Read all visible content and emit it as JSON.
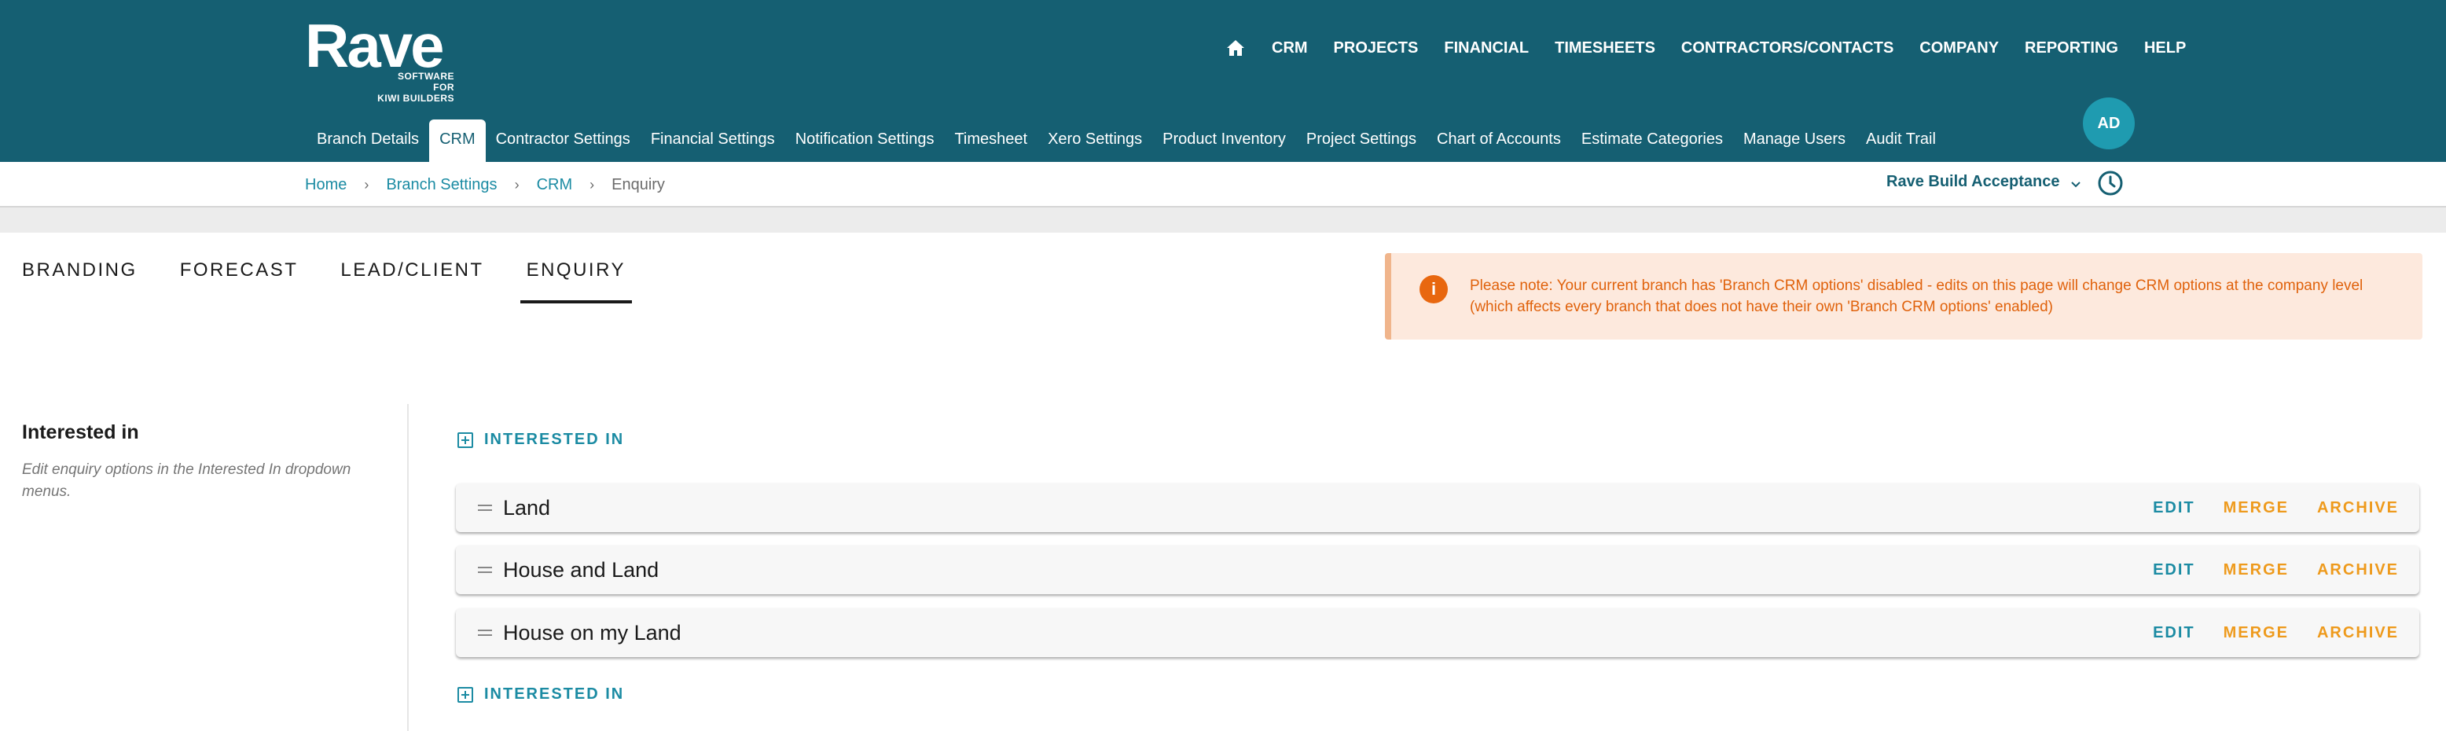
{
  "brand": {
    "name": "Rave",
    "tagline_line1": "SOFTWARE FOR",
    "tagline_line2": "KIWI BUILDERS"
  },
  "top_nav": {
    "home_icon": "home-icon",
    "items": [
      "CRM",
      "PROJECTS",
      "FINANCIAL",
      "TIMESHEETS",
      "CONTRACTORS/CONTACTS",
      "COMPANY",
      "REPORTING",
      "HELP"
    ]
  },
  "user": {
    "initials": "AD"
  },
  "settings_tabs": {
    "items": [
      "Branch Details",
      "CRM",
      "Contractor Settings",
      "Financial Settings",
      "Notification Settings",
      "Timesheet",
      "Xero Settings",
      "Product Inventory",
      "Project Settings",
      "Chart of Accounts",
      "Estimate Categories",
      "Manage Users",
      "Audit Trail"
    ],
    "active": "CRM"
  },
  "breadcrumb": {
    "items": [
      "Home",
      "Branch Settings",
      "CRM",
      "Enquiry"
    ],
    "separator": "›"
  },
  "branch_selector": {
    "value": "Rave Build Acceptance"
  },
  "crm_tabs": {
    "items": [
      "BRANDING",
      "FORECAST",
      "LEAD/CLIENT",
      "ENQUIRY"
    ],
    "active": "ENQUIRY"
  },
  "notice": {
    "icon": "info-icon",
    "line1": "Please note: Your current branch has 'Branch CRM options' disabled - edits on this page will change CRM options at the company level",
    "line2": "(which affects every branch that does not have their own 'Branch CRM options' enabled)"
  },
  "section": {
    "title": "Interested in",
    "description": "Edit enquiry options in the Interested In dropdown menus.",
    "add_label": "INTERESTED IN",
    "options": [
      {
        "label": "Land"
      },
      {
        "label": "House and Land"
      },
      {
        "label": "House on my Land"
      }
    ],
    "actions": {
      "edit": "EDIT",
      "merge": "MERGE",
      "archive": "ARCHIVE"
    }
  },
  "colors": {
    "header_bg": "#155f72",
    "link": "#1b8ba3",
    "warning_text": "#e0620c",
    "warning_bg": "#fde9dd",
    "merge_archive": "#ee9a1c"
  }
}
